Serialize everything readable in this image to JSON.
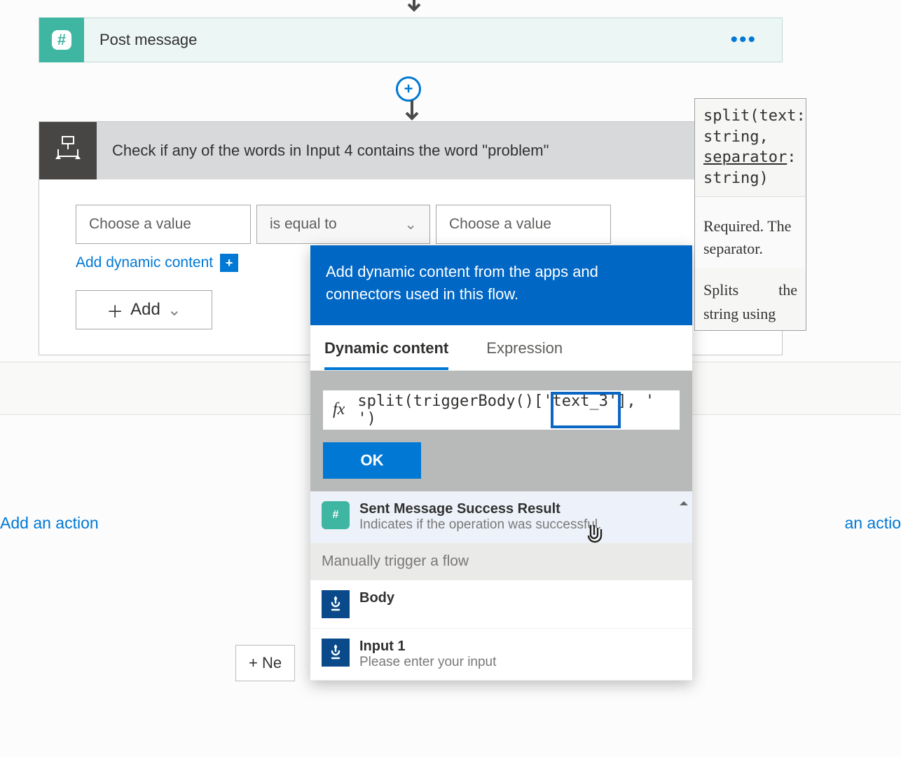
{
  "post_card": {
    "title": "Post message"
  },
  "condition": {
    "title": "Check if any of the words in Input 4 contains the word \"problem\"",
    "value1_placeholder": "Choose a value",
    "operator": "is equal to",
    "value2_placeholder": "Choose a value",
    "add_dynamic": "Add dynamic content",
    "add_button": "Add"
  },
  "links": {
    "add_action_left": "Add an action",
    "add_action_right": "an actio",
    "new_step": "+ Ne"
  },
  "popup": {
    "header": "Add dynamic content from the apps and connectors used in this flow.",
    "tab_dynamic": "Dynamic content",
    "tab_expression": "Expression",
    "fx_label": "fx",
    "expression": "split(triggerBody()['text_3'], ' ')",
    "ok": "OK",
    "items": [
      {
        "kind": "result",
        "title": "Sent Message Success Result",
        "subtitle": "Indicates if the operation was successful."
      },
      {
        "kind": "section",
        "title": "Manually trigger a flow"
      },
      {
        "kind": "trigger",
        "title": "Body",
        "subtitle": ""
      },
      {
        "kind": "trigger",
        "title": "Input 1",
        "subtitle": "Please enter your input"
      }
    ]
  },
  "tooltip": {
    "sig_line1": "split(text:",
    "sig_line2": "string,",
    "sig_sep": "separator",
    "sig_colon": ":",
    "sig_line4": "string)",
    "req": "Required. The separator.",
    "more1": "Splits",
    "more2": "the",
    "cut": "string using"
  }
}
